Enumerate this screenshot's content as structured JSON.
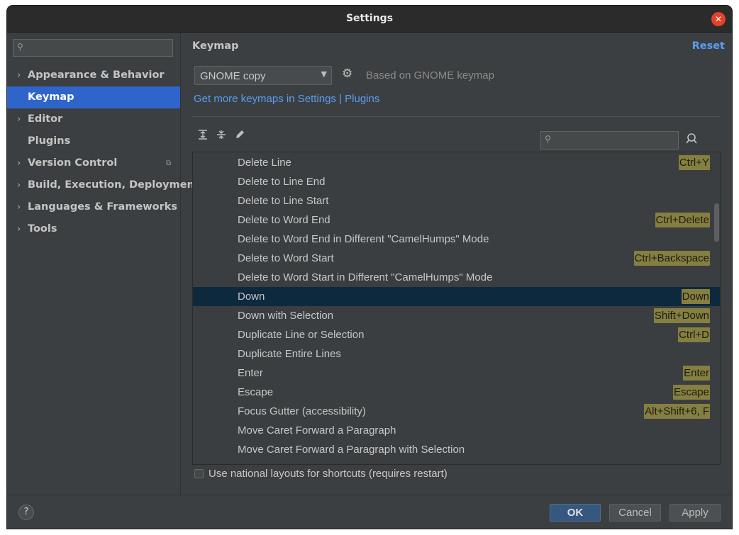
{
  "window": {
    "title": "Settings"
  },
  "sidebar": {
    "search_placeholder": "",
    "items": [
      {
        "label": "Appearance & Behavior",
        "expandable": true
      },
      {
        "label": "Keymap",
        "expandable": false,
        "selected": true
      },
      {
        "label": "Editor",
        "expandable": true
      },
      {
        "label": "Plugins",
        "expandable": false
      },
      {
        "label": "Version Control",
        "expandable": true,
        "project_icon": true
      },
      {
        "label": "Build, Execution, Deployment",
        "expandable": true
      },
      {
        "label": "Languages & Frameworks",
        "expandable": true
      },
      {
        "label": "Tools",
        "expandable": true
      }
    ]
  },
  "main": {
    "title": "Keymap",
    "reset_label": "Reset",
    "keymap_selected": "GNOME copy",
    "based_on": "Based on GNOME keymap",
    "more_keymaps_link": "Get more keymaps in Settings | Plugins",
    "actions": [
      {
        "name": "Delete Line",
        "shortcut": "Ctrl+Y"
      },
      {
        "name": "Delete to Line End",
        "shortcut": ""
      },
      {
        "name": "Delete to Line Start",
        "shortcut": ""
      },
      {
        "name": "Delete to Word End",
        "shortcut": "Ctrl+Delete"
      },
      {
        "name": "Delete to Word End in Different \"CamelHumps\" Mode",
        "shortcut": ""
      },
      {
        "name": "Delete to Word Start",
        "shortcut": "Ctrl+Backspace"
      },
      {
        "name": "Delete to Word Start in Different \"CamelHumps\" Mode",
        "shortcut": ""
      },
      {
        "name": "Down",
        "shortcut": "Down",
        "selected": true
      },
      {
        "name": "Down with Selection",
        "shortcut": "Shift+Down"
      },
      {
        "name": "Duplicate Line or Selection",
        "shortcut": "Ctrl+D"
      },
      {
        "name": "Duplicate Entire Lines",
        "shortcut": ""
      },
      {
        "name": "Enter",
        "shortcut": "Enter"
      },
      {
        "name": "Escape",
        "shortcut": "Escape"
      },
      {
        "name": "Focus Gutter (accessibility)",
        "shortcut": "Alt+Shift+6, F"
      },
      {
        "name": "Move Caret Forward a Paragraph",
        "shortcut": ""
      },
      {
        "name": "Move Caret Forward a Paragraph with Selection",
        "shortcut": ""
      }
    ],
    "national_layouts_label": "Use national layouts for shortcuts (requires restart)",
    "national_layouts_checked": false
  },
  "footer": {
    "help_label": "?",
    "ok_label": "OK",
    "cancel_label": "Cancel",
    "apply_label": "Apply"
  },
  "colors": {
    "accent": "#2f65ca",
    "link": "#589df6",
    "shortcut_highlight": "#857f41",
    "selected_row": "#0d293e",
    "close_button": "#e2412b"
  }
}
